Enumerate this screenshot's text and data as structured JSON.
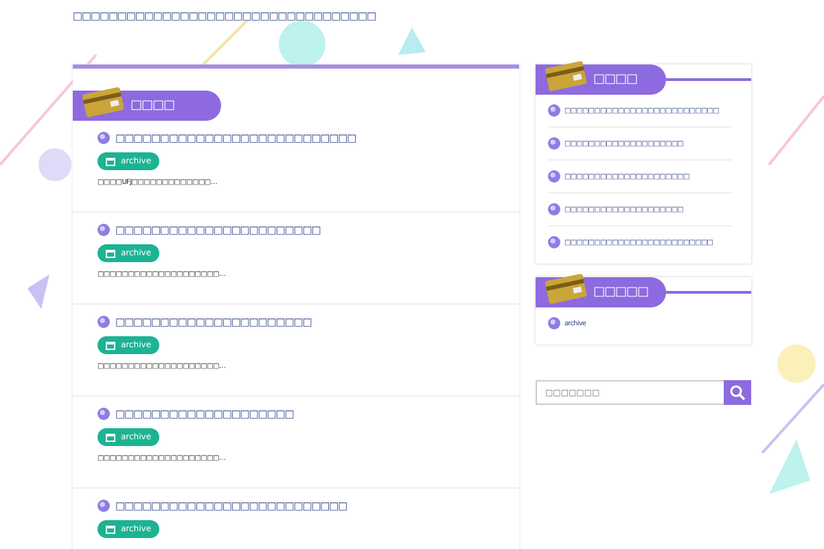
{
  "site_title": "□□□□□□□□□□□□□□□□□□□□□□□□□□□□□□□□□□",
  "main": {
    "heading": "□□□□",
    "posts": [
      {
        "title": "□□□□□□□□□□□□□□□□□□□□□□□□□□□",
        "category": "archive",
        "excerpt": "□□□□UFJ□□□□□□□□□□□□□…"
      },
      {
        "title": "□□□□□□□□□□□□□□□□□□□□□□□",
        "category": "archive",
        "excerpt": "□□□□□□□□□□□□□□□□□□□□…"
      },
      {
        "title": "□□□□□□□□□□□□□□□□□□□□□□",
        "category": "archive",
        "excerpt": "□□□□□□□□□□□□□□□□□□□□…"
      },
      {
        "title": "□□□□□□□□□□□□□□□□□□□□",
        "category": "archive",
        "excerpt": "□□□□□□□□□□□□□□□□□□□□…"
      },
      {
        "title": "□□□□□□□□□□□□□□□□□□□□□□□□□□",
        "category": "archive"
      }
    ]
  },
  "sidebar": {
    "widgets": [
      {
        "heading": "□□□□",
        "items": [
          "□□□□□□□□□□□□□□□□□□□□□□□□□□",
          "□□□□□□□□□□□□□□□□□□□□",
          "□□□□□□□□□□□□□□□□□□□□□",
          "□□□□□□□□□□□□□□□□□□□□",
          "□□□□□□□□□□□□□□□□□□□□□□□□□"
        ]
      },
      {
        "heading": "□□□□□",
        "items": [
          "archive"
        ]
      }
    ],
    "search": {
      "placeholder": "□□□□□□□"
    }
  }
}
